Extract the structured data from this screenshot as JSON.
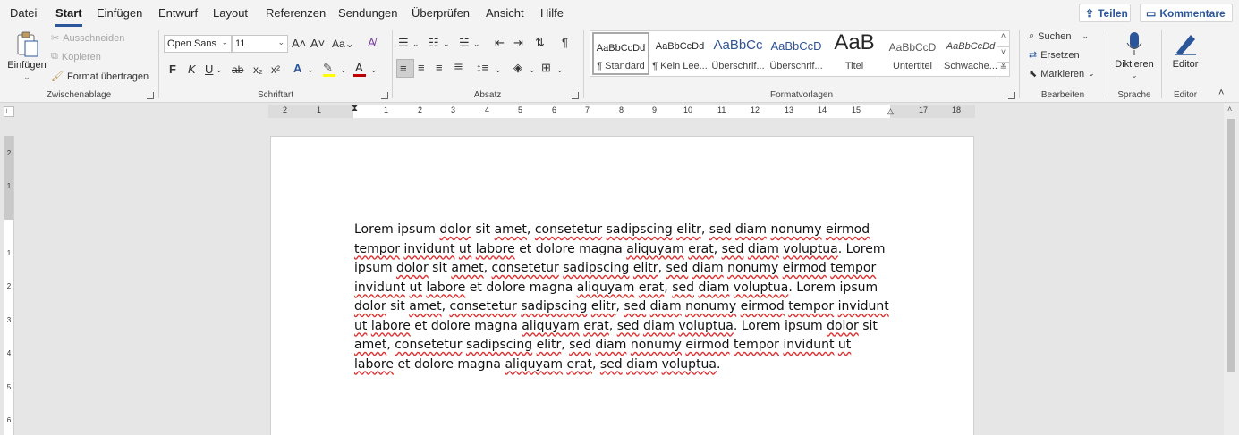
{
  "menu": {
    "tabs": [
      "Datei",
      "Start",
      "Einfügen",
      "Entwurf",
      "Layout",
      "Referenzen",
      "Sendungen",
      "Überprüfen",
      "Ansicht",
      "Hilfe"
    ],
    "active_tab": "Start",
    "share_label": "Teilen",
    "comments_label": "Kommentare"
  },
  "clipboard": {
    "paste_label": "Einfügen",
    "cut_label": "Ausschneiden",
    "copy_label": "Kopieren",
    "format_painter_label": "Format übertragen",
    "group_label": "Zwischenablage"
  },
  "font": {
    "family": "Open Sans",
    "size": "11",
    "case_label": "Aa",
    "bold": "F",
    "italic": "K",
    "underline": "U",
    "strike": "ab",
    "subscript": "x₂",
    "superscript": "x²",
    "group_label": "Schriftart"
  },
  "paragraph": {
    "group_label": "Absatz"
  },
  "styles": {
    "items": [
      {
        "preview": "AaBbCcDd",
        "name": "¶ Standard"
      },
      {
        "preview": "AaBbCcDd",
        "name": "¶ Kein Lee..."
      },
      {
        "preview": "AaBbCc",
        "name": "Überschrif..."
      },
      {
        "preview": "AaBbCcD",
        "name": "Überschrif..."
      },
      {
        "preview": "AaB",
        "name": "Titel"
      },
      {
        "preview": "AaBbCcD",
        "name": "Untertitel"
      },
      {
        "preview": "AaBbCcDd",
        "name": "Schwache..."
      }
    ],
    "group_label": "Formatvorlagen"
  },
  "editing": {
    "find_label": "Suchen",
    "replace_label": "Ersetzen",
    "select_label": "Markieren",
    "group_label": "Bearbeiten"
  },
  "voice": {
    "dictate_label": "Diktieren",
    "group_label": "Sprache"
  },
  "editor": {
    "editor_label": "Editor",
    "group_label": "Editor"
  },
  "ruler": {
    "h_labels": [
      "2",
      "1",
      "1",
      "2",
      "3",
      "4",
      "5",
      "6",
      "7",
      "8",
      "9",
      "10",
      "11",
      "12",
      "13",
      "14",
      "15",
      "16",
      "17",
      "18"
    ],
    "v_labels": [
      "2",
      "1",
      "1",
      "2",
      "3",
      "4",
      "5",
      "6"
    ]
  },
  "document": {
    "text": "Lorem ipsum dolor sit amet, consetetur sadipscing elitr, sed diam nonumy eirmod tempor invidunt ut labore et dolore magna aliquyam erat, sed diam voluptua. Lorem ipsum dolor sit amet, consetetur sadipscing elitr, sed diam nonumy eirmod tempor invidunt ut labore et dolore magna aliquyam erat, sed diam voluptua. Lorem ipsum dolor sit amet, consetetur sadipscing elitr, sed diam nonumy eirmod tempor invidunt ut labore et dolore magna aliquyam erat, sed diam voluptua. Lorem ipsum dolor sit amet, consetetur sadipscing elitr, sed diam nonumy eirmod tempor invidunt ut labore et dolore magna aliquyam erat, sed diam voluptua."
  },
  "colors": {
    "accent": "#2b579a",
    "highlight": "#ffff00",
    "font_color": "#c00000",
    "spelling_underline": "#d33333"
  }
}
